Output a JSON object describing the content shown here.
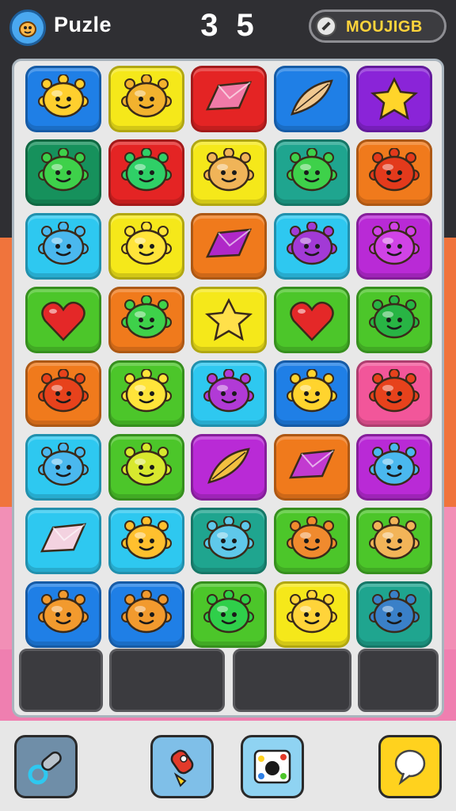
{
  "header": {
    "app_title": "Puzle",
    "logo_icon": "creature-logo-icon",
    "score": "3 5",
    "mode_label": "MOUJIGB",
    "mode_icon": "pen-icon"
  },
  "colors": {
    "blue": "#1f7fe6",
    "yellow": "#f5e81a",
    "red": "#e42424",
    "purple": "#8a24d8",
    "dark-green": "#16915c",
    "teal": "#1fa58f",
    "orange": "#f07a1c",
    "cyan": "#2ec8f0",
    "violet": "#b92ad6",
    "green": "#4cc62a",
    "pink": "#f2569a"
  },
  "board": {
    "rows": [
      [
        {
          "bg": "blue",
          "piece": "blob",
          "color": "#ffcf2e",
          "icon": "yellow-spiky-blob-icon"
        },
        {
          "bg": "yellow",
          "piece": "blob",
          "color": "#f2b22e",
          "icon": "orange-leafy-blob-icon"
        },
        {
          "bg": "red",
          "piece": "gem",
          "color": "#f07aa8",
          "icon": "pink-gem-icon"
        },
        {
          "bg": "blue",
          "piece": "leaf",
          "color": "#f0c890",
          "icon": "tan-leaf-icon"
        },
        {
          "bg": "purple",
          "piece": "star",
          "color": "#ffd52a",
          "icon": "yellow-star-icon"
        }
      ],
      [
        {
          "bg": "dark-green",
          "piece": "blob",
          "color": "#3ed14a",
          "icon": "green-spiky-blob-icon"
        },
        {
          "bg": "red",
          "piece": "blob",
          "color": "#2fd067",
          "icon": "green-fish-blob-icon"
        },
        {
          "bg": "yellow",
          "piece": "blob",
          "color": "#f0b458",
          "icon": "tan-blob-icon"
        },
        {
          "bg": "teal",
          "piece": "blob",
          "color": "#3ed14a",
          "icon": "green-spiky-blob-icon"
        },
        {
          "bg": "orange",
          "piece": "blob",
          "color": "#e33a1c",
          "icon": "red-spiky-blob-icon"
        }
      ],
      [
        {
          "bg": "cyan",
          "piece": "blob",
          "color": "#4ab8ee",
          "icon": "blue-spiky-blob-icon"
        },
        {
          "bg": "yellow",
          "piece": "blob",
          "color": "#ffe43a",
          "icon": "yellow-blob-icon"
        },
        {
          "bg": "orange",
          "piece": "gem",
          "color": "#b028c8",
          "icon": "purple-gem-icon"
        },
        {
          "bg": "cyan",
          "piece": "blob",
          "color": "#a23ad6",
          "icon": "purple-fish-blob-icon"
        },
        {
          "bg": "violet",
          "piece": "blob",
          "color": "#d043e6",
          "icon": "purple-spiky-blob-icon"
        }
      ],
      [
        {
          "bg": "green",
          "piece": "heart",
          "color": "#e42828",
          "icon": "red-heart-icon"
        },
        {
          "bg": "orange",
          "piece": "blob",
          "color": "#3ed14a",
          "icon": "green-spiky-blob-icon"
        },
        {
          "bg": "yellow",
          "piece": "star",
          "color": "#ffe04a",
          "icon": "yellow-star-icon"
        },
        {
          "bg": "green",
          "piece": "heart",
          "color": "#e42828",
          "icon": "red-heart-icon"
        },
        {
          "bg": "green",
          "piece": "blob",
          "color": "#28b444",
          "icon": "green-spiky-blob-icon"
        }
      ],
      [
        {
          "bg": "orange",
          "piece": "blob",
          "color": "#e7421c",
          "icon": "red-spiky-blob-icon"
        },
        {
          "bg": "green",
          "piece": "blob",
          "color": "#ffe43a",
          "icon": "yellow-blob-icon"
        },
        {
          "bg": "cyan",
          "piece": "blob",
          "color": "#b13ad6",
          "icon": "purple-blob-icon"
        },
        {
          "bg": "blue",
          "piece": "blob",
          "color": "#ffd42e",
          "icon": "yellow-spiky-blob-icon"
        },
        {
          "bg": "pink",
          "piece": "blob",
          "color": "#e7421c",
          "icon": "red-spiky-blob-icon"
        }
      ],
      [
        {
          "bg": "cyan",
          "piece": "blob",
          "color": "#4ab8ee",
          "icon": "blue-spiky-blob-icon"
        },
        {
          "bg": "green",
          "piece": "blob",
          "color": "#d8e82e",
          "icon": "lime-spiky-blob-icon"
        },
        {
          "bg": "violet",
          "piece": "leaf",
          "color": "#f2c040",
          "icon": "yellow-leaf-icon"
        },
        {
          "bg": "orange",
          "piece": "gem",
          "color": "#c23ad0",
          "icon": "purple-gem-icon"
        },
        {
          "bg": "violet",
          "piece": "blob",
          "color": "#4ab8ee",
          "icon": "blue-spiky-blob-icon"
        }
      ],
      [
        {
          "bg": "cyan",
          "piece": "gem",
          "color": "#f3d2e0",
          "icon": "white-gem-icon"
        },
        {
          "bg": "cyan",
          "piece": "blob",
          "color": "#ffc02e",
          "icon": "orange-blob-icon"
        },
        {
          "bg": "teal",
          "piece": "blob",
          "color": "#5fc8ea",
          "icon": "blue-spiky-blob-icon"
        },
        {
          "bg": "green",
          "piece": "blob",
          "color": "#f08a2e",
          "icon": "orange-blob-icon"
        },
        {
          "bg": "green",
          "piece": "blob",
          "color": "#f2b458",
          "icon": "tan-spiky-blob-icon"
        }
      ],
      [
        {
          "bg": "blue",
          "piece": "blob",
          "color": "#f29a2e",
          "icon": "orange-spiky-blob-icon"
        },
        {
          "bg": "blue",
          "piece": "blob",
          "color": "#f29a2e",
          "icon": "orange-spiky-blob-icon"
        },
        {
          "bg": "green",
          "piece": "blob",
          "color": "#2fcf4a",
          "icon": "green-spiky-blob-icon"
        },
        {
          "bg": "yellow",
          "piece": "blob",
          "color": "#ffd43a",
          "icon": "yellow-spiky-blob-icon"
        },
        {
          "bg": "teal",
          "piece": "blob",
          "color": "#3a80c8",
          "icon": "blue-spiky-blob-icon"
        }
      ]
    ],
    "empty_slots": 4
  },
  "toolbar": {
    "tools": [
      {
        "icon": "bullet-ring-icon",
        "bg": "#6f8ea8"
      },
      {
        "icon": "rocket-icon",
        "bg": "#7fbfe8"
      },
      {
        "icon": "camera-dots-icon",
        "bg": "#8fd3f2"
      },
      {
        "icon": "speech-bubble-icon",
        "bg": "#ffd21e"
      }
    ]
  }
}
